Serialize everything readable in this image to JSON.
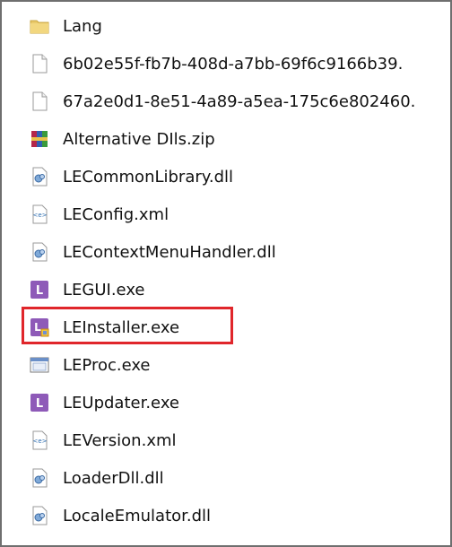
{
  "files": [
    {
      "name": "Lang",
      "icon": "folder-icon"
    },
    {
      "name": "6b02e55f-fb7b-408d-a7bb-69f6c9166b39.",
      "icon": "blank-file-icon"
    },
    {
      "name": "67a2e0d1-8e51-4a89-a5ea-175c6e802460.",
      "icon": "blank-file-icon"
    },
    {
      "name": "Alternative DIls.zip",
      "icon": "winrar-archive-icon"
    },
    {
      "name": "LECommonLibrary.dll",
      "icon": "dll-icon"
    },
    {
      "name": "LEConfig.xml",
      "icon": "xml-icon"
    },
    {
      "name": "LEContextMenuHandler.dll",
      "icon": "dll-icon"
    },
    {
      "name": "LEGUI.exe",
      "icon": "le-app-icon"
    },
    {
      "name": "LEInstaller.exe",
      "icon": "le-installer-icon"
    },
    {
      "name": "LEProc.exe",
      "icon": "exe-window-icon"
    },
    {
      "name": "LEUpdater.exe",
      "icon": "le-app-icon"
    },
    {
      "name": "LEVersion.xml",
      "icon": "xml-icon"
    },
    {
      "name": "LoaderDll.dll",
      "icon": "dll-icon"
    },
    {
      "name": "LocaleEmulator.dll",
      "icon": "dll-icon"
    }
  ],
  "highlighted_item": "LEInstaller.exe",
  "colors": {
    "highlight_border": "#e0262b",
    "le_icon": "#8e5ab8",
    "frame_border": "#6f6f6f"
  }
}
